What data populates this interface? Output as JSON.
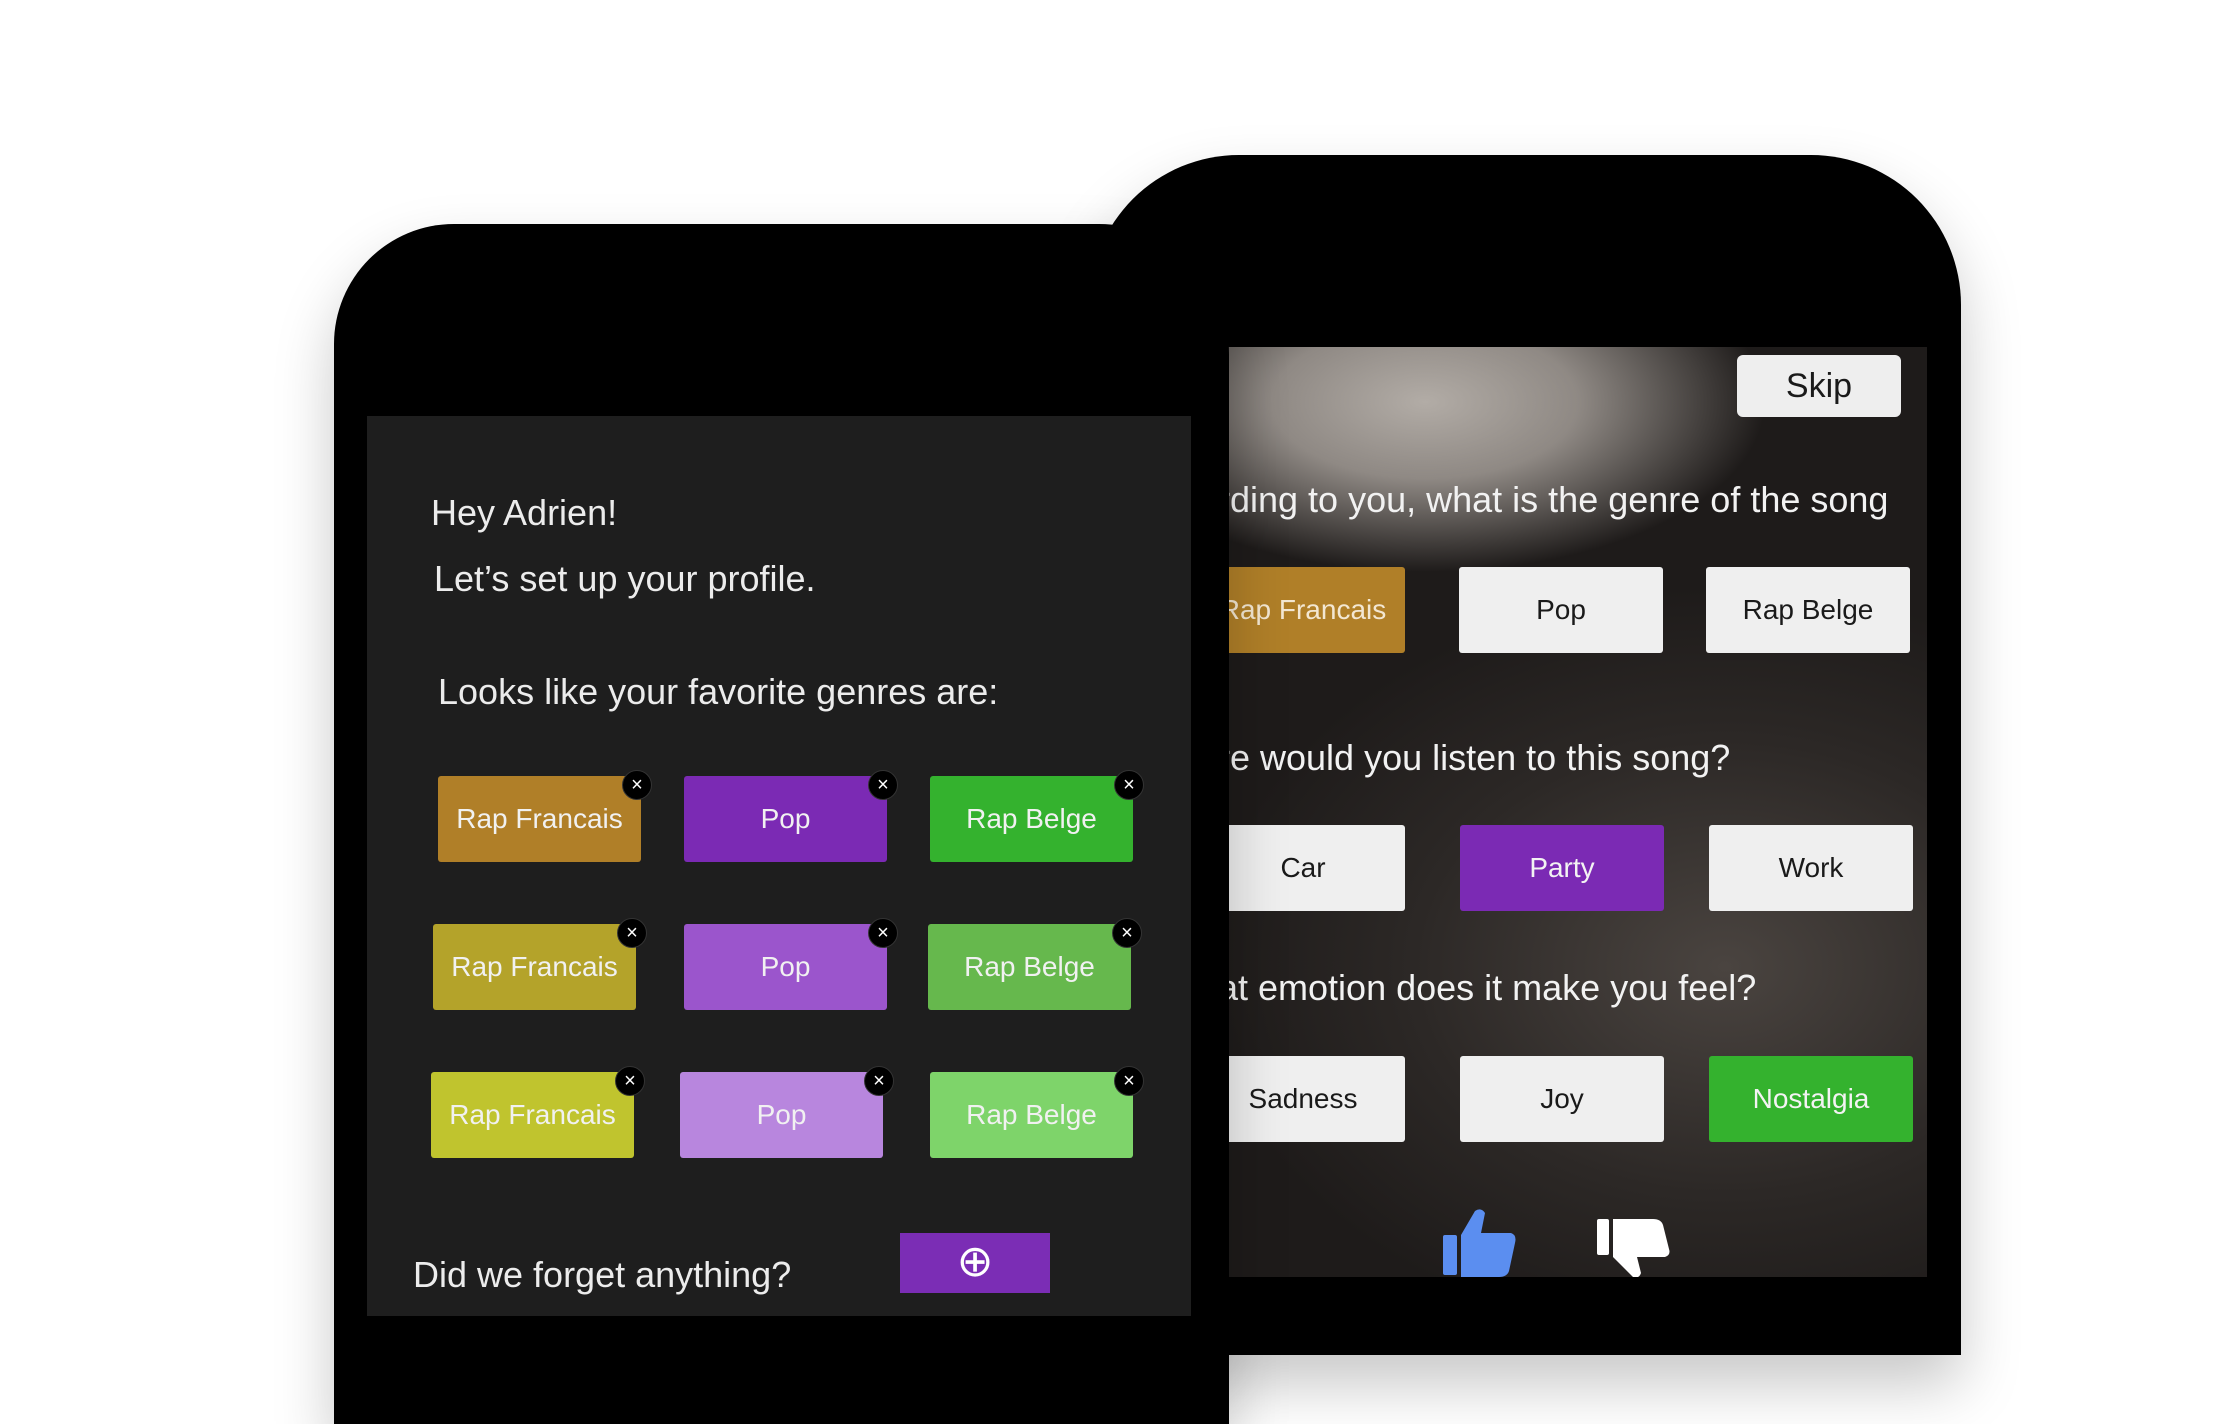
{
  "profile": {
    "greeting": "Hey Adrien!",
    "subtitle": "Let’s set up your profile.",
    "genres_heading": "Looks like your favorite genres are:",
    "genre_chips": [
      {
        "label": "Rap Francais",
        "color": "#b07f28"
      },
      {
        "label": "Pop",
        "color": "#7b2ab4"
      },
      {
        "label": "Rap Belge",
        "color": "#34b22e"
      },
      {
        "label": "Rap Francais",
        "color": "#b4a32a"
      },
      {
        "label": "Pop",
        "color": "#9b55cc"
      },
      {
        "label": "Rap Belge",
        "color": "#66b84d"
      },
      {
        "label": "Rap Francais",
        "color": "#c0c42e"
      },
      {
        "label": "Pop",
        "color": "#b886de"
      },
      {
        "label": "Rap Belge",
        "color": "#7ed46a"
      }
    ],
    "remove_glyph": "×",
    "forgot_text": "Did we forget anything?",
    "add_icon": "plus-circle-icon",
    "add_glyph": "⊕"
  },
  "quiz": {
    "skip_label": "Skip",
    "q_genre": "rding to you, what is the genre of the song",
    "genre_options": [
      {
        "label": "Rap Francais",
        "selected": true,
        "color": "#b07f28"
      },
      {
        "label": "Pop",
        "selected": false
      },
      {
        "label": "Rap Belge",
        "selected": false
      }
    ],
    "q_where": "re would you listen to this song?",
    "where_options": [
      {
        "label": "Car",
        "selected": false
      },
      {
        "label": "Party",
        "selected": true,
        "color": "#7b2ab4"
      },
      {
        "label": "Work",
        "selected": false
      }
    ],
    "q_emotion": "at emotion does it make you feel?",
    "emotion_options": [
      {
        "label": "Sadness",
        "selected": false
      },
      {
        "label": "Joy",
        "selected": false
      },
      {
        "label": "Nostalgia",
        "selected": true,
        "color": "#34b22e"
      }
    ],
    "like_icon": "thumbs-up-icon",
    "dislike_icon": "thumbs-down-icon",
    "like_color": "#5b8ef0",
    "dislike_color": "#ffffff"
  }
}
